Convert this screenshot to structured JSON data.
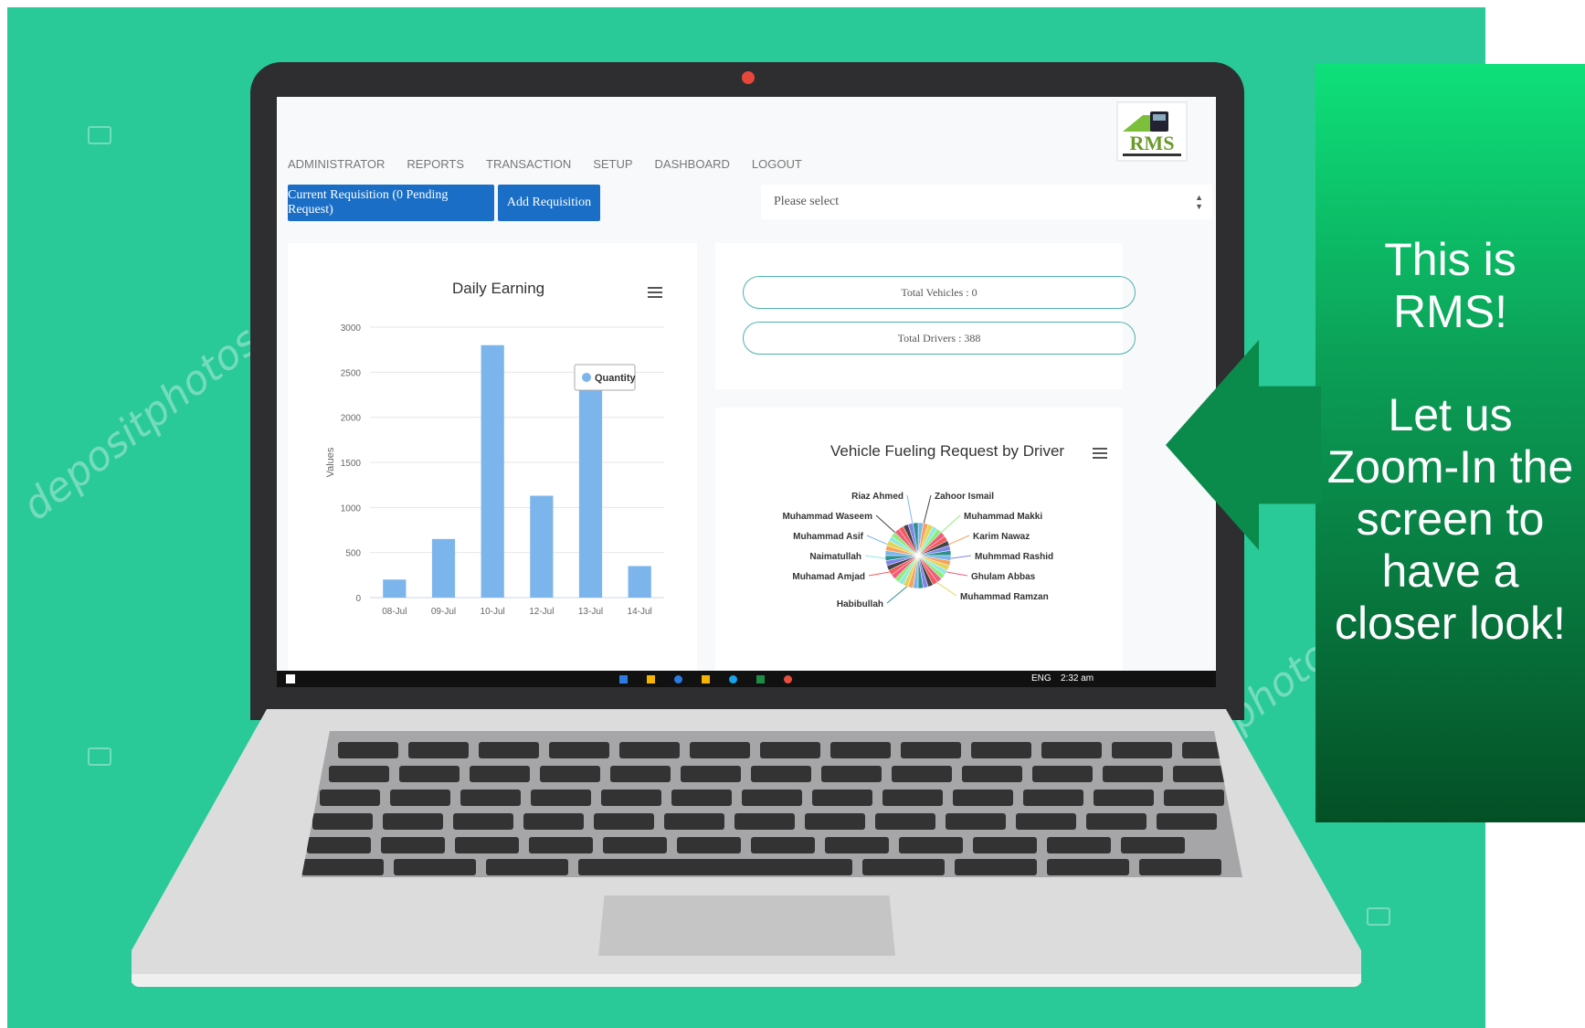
{
  "watermark": "depositphotos",
  "nav": {
    "items": [
      "ADMINISTRATOR",
      "REPORTS",
      "TRANSACTION",
      "SETUP",
      "DASHBOARD",
      "LOGOUT"
    ]
  },
  "logo": {
    "text": "RMS"
  },
  "toolbar": {
    "current_requisition": "Current Requisition (0 Pending Request)",
    "add_requisition": "Add Requisition"
  },
  "select": {
    "value": "Please select"
  },
  "stats": {
    "total_vehicles": "Total Vehicles : 0",
    "total_drivers": "Total Drivers : 388"
  },
  "taskbar": {
    "language": "ENG",
    "time": "2:32 am"
  },
  "callout": {
    "line1": "This is",
    "line2": "RMS!",
    "line3": "Let us",
    "line4": "Zoom-In the",
    "line5": "screen to",
    "line6": "have a",
    "line7": "closer look!"
  },
  "colors": {
    "background": "#2ac998",
    "bar": "#7cb5ec",
    "button": "#1a6ec6"
  },
  "chart_data": [
    {
      "type": "bar",
      "title": "Daily Earning",
      "ylabel": "Values",
      "categories": [
        "08-Jul",
        "09-Jul",
        "10-Jul",
        "12-Jul",
        "13-Jul",
        "14-Jul"
      ],
      "series": [
        {
          "name": "Quantity",
          "values": [
            200,
            650,
            2800,
            1130,
            2400,
            350
          ]
        }
      ],
      "ylim": [
        0,
        3000
      ],
      "yticks": [
        0,
        500,
        1000,
        1500,
        2000,
        2500,
        3000
      ],
      "legend": "top-right",
      "grid": true
    },
    {
      "type": "pie",
      "title": "Vehicle Fueling Request by Driver",
      "labels": [
        "Riaz Ahmed",
        "Zahoor Ismail",
        "Muhammad Makki",
        "Karim Nawaz",
        "Muhmmad Rashid",
        "Ghulam Abbas",
        "Muhammad Ramzan",
        "Habibullah",
        "Muhamad Amjad",
        "Naimatullah",
        "Muhammad Asif",
        "Muhammad Waseem"
      ],
      "slice_count": 40
    }
  ]
}
